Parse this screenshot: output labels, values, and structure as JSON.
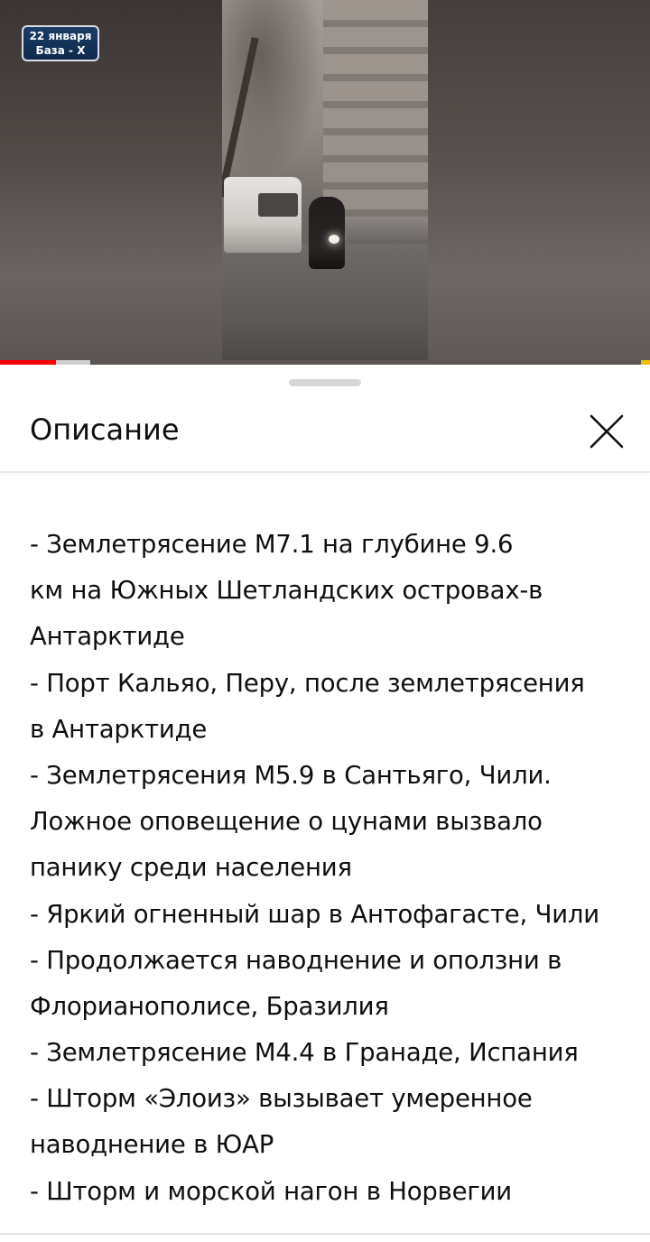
{
  "video": {
    "badge": {
      "line1": "22 января",
      "line2": "База - X"
    },
    "progress_played_fraction": 0.086,
    "progress_buffered_fraction": 0.139,
    "colors": {
      "played": "#ff0000",
      "buffered": "#cfcfcf"
    }
  },
  "sheet": {
    "title": "Описание",
    "close_icon": "close-icon",
    "description_lines": [
      "- Землетрясение M7.1 на глубине 9.6",
      "км на Южных Шетландских островах-в",
      "Антарктиде",
      "- Порт Кальяо, Перу, после землетрясения",
      "в Антарктиде",
      "- Землетрясения M5.9 в Сантьяго, Чили.",
      "Ложное оповещение о цунами вызвало",
      "панику среди населения",
      "- Яркий огненный шар в Антофагасте, Чили",
      "- Продолжается наводнение и оползни в",
      "Флорианополисе, Бразилия",
      "- Землетрясение M4.4 в Гранаде, Испания",
      "- Шторм «Элоиз» вызывает умеренное",
      "наводнение в ЮАР",
      "- Шторм и морской нагон в Норвегии"
    ]
  }
}
